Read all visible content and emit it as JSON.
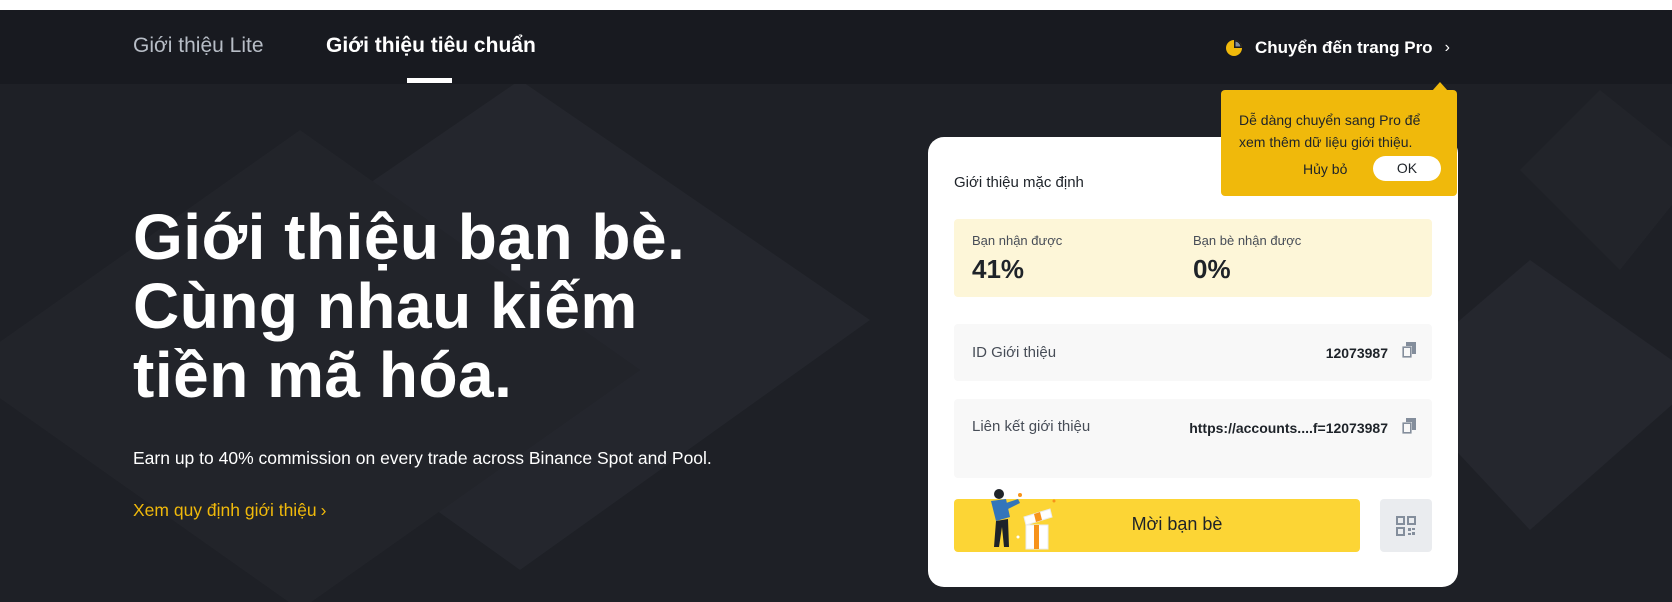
{
  "colors": {
    "background": "#1e2026",
    "topbar": "#181a20",
    "accent": "#f0b90b",
    "button": "#fcd535",
    "rate_panel": "#fdf6d8"
  },
  "nav": {
    "tabs": [
      {
        "label": "Giới thiệu Lite",
        "active": false
      },
      {
        "label": "Giới thiệu tiêu chuẩn",
        "active": true
      }
    ],
    "pro_link": {
      "icon": "pie-chart-icon",
      "label": "Chuyển đến trang Pro",
      "chevron": "›"
    }
  },
  "hero": {
    "title": "Giới thiệu bạn bè. Cùng nhau kiếm tiền mã hóa.",
    "subtitle": "Earn up to 40% commission on every trade across Binance Spot and Pool.",
    "rules_link": "Xem quy định giới thiệu",
    "rules_chevron": "›"
  },
  "card": {
    "title": "Giới thiệu mặc định",
    "you_receive": {
      "label": "Bạn nhận được",
      "value": "41%"
    },
    "friend_receives": {
      "label": "Bạn bè nhận được",
      "value": "0%"
    },
    "referral_id": {
      "label": "ID Giới thiệu",
      "value": "12073987",
      "icon": "copy-icon"
    },
    "referral_link": {
      "label": "Liên kết giới thiệu",
      "value": "https://accounts....f=12073987",
      "icon": "copy-icon"
    },
    "invite_button": "Mời bạn bè",
    "qr_button_icon": "qr-code-icon"
  },
  "tooltip": {
    "text": "Dễ dàng chuyển sang Pro để xem thêm dữ liệu giới thiệu.",
    "cancel": "Hủy bỏ",
    "ok": "OK"
  }
}
